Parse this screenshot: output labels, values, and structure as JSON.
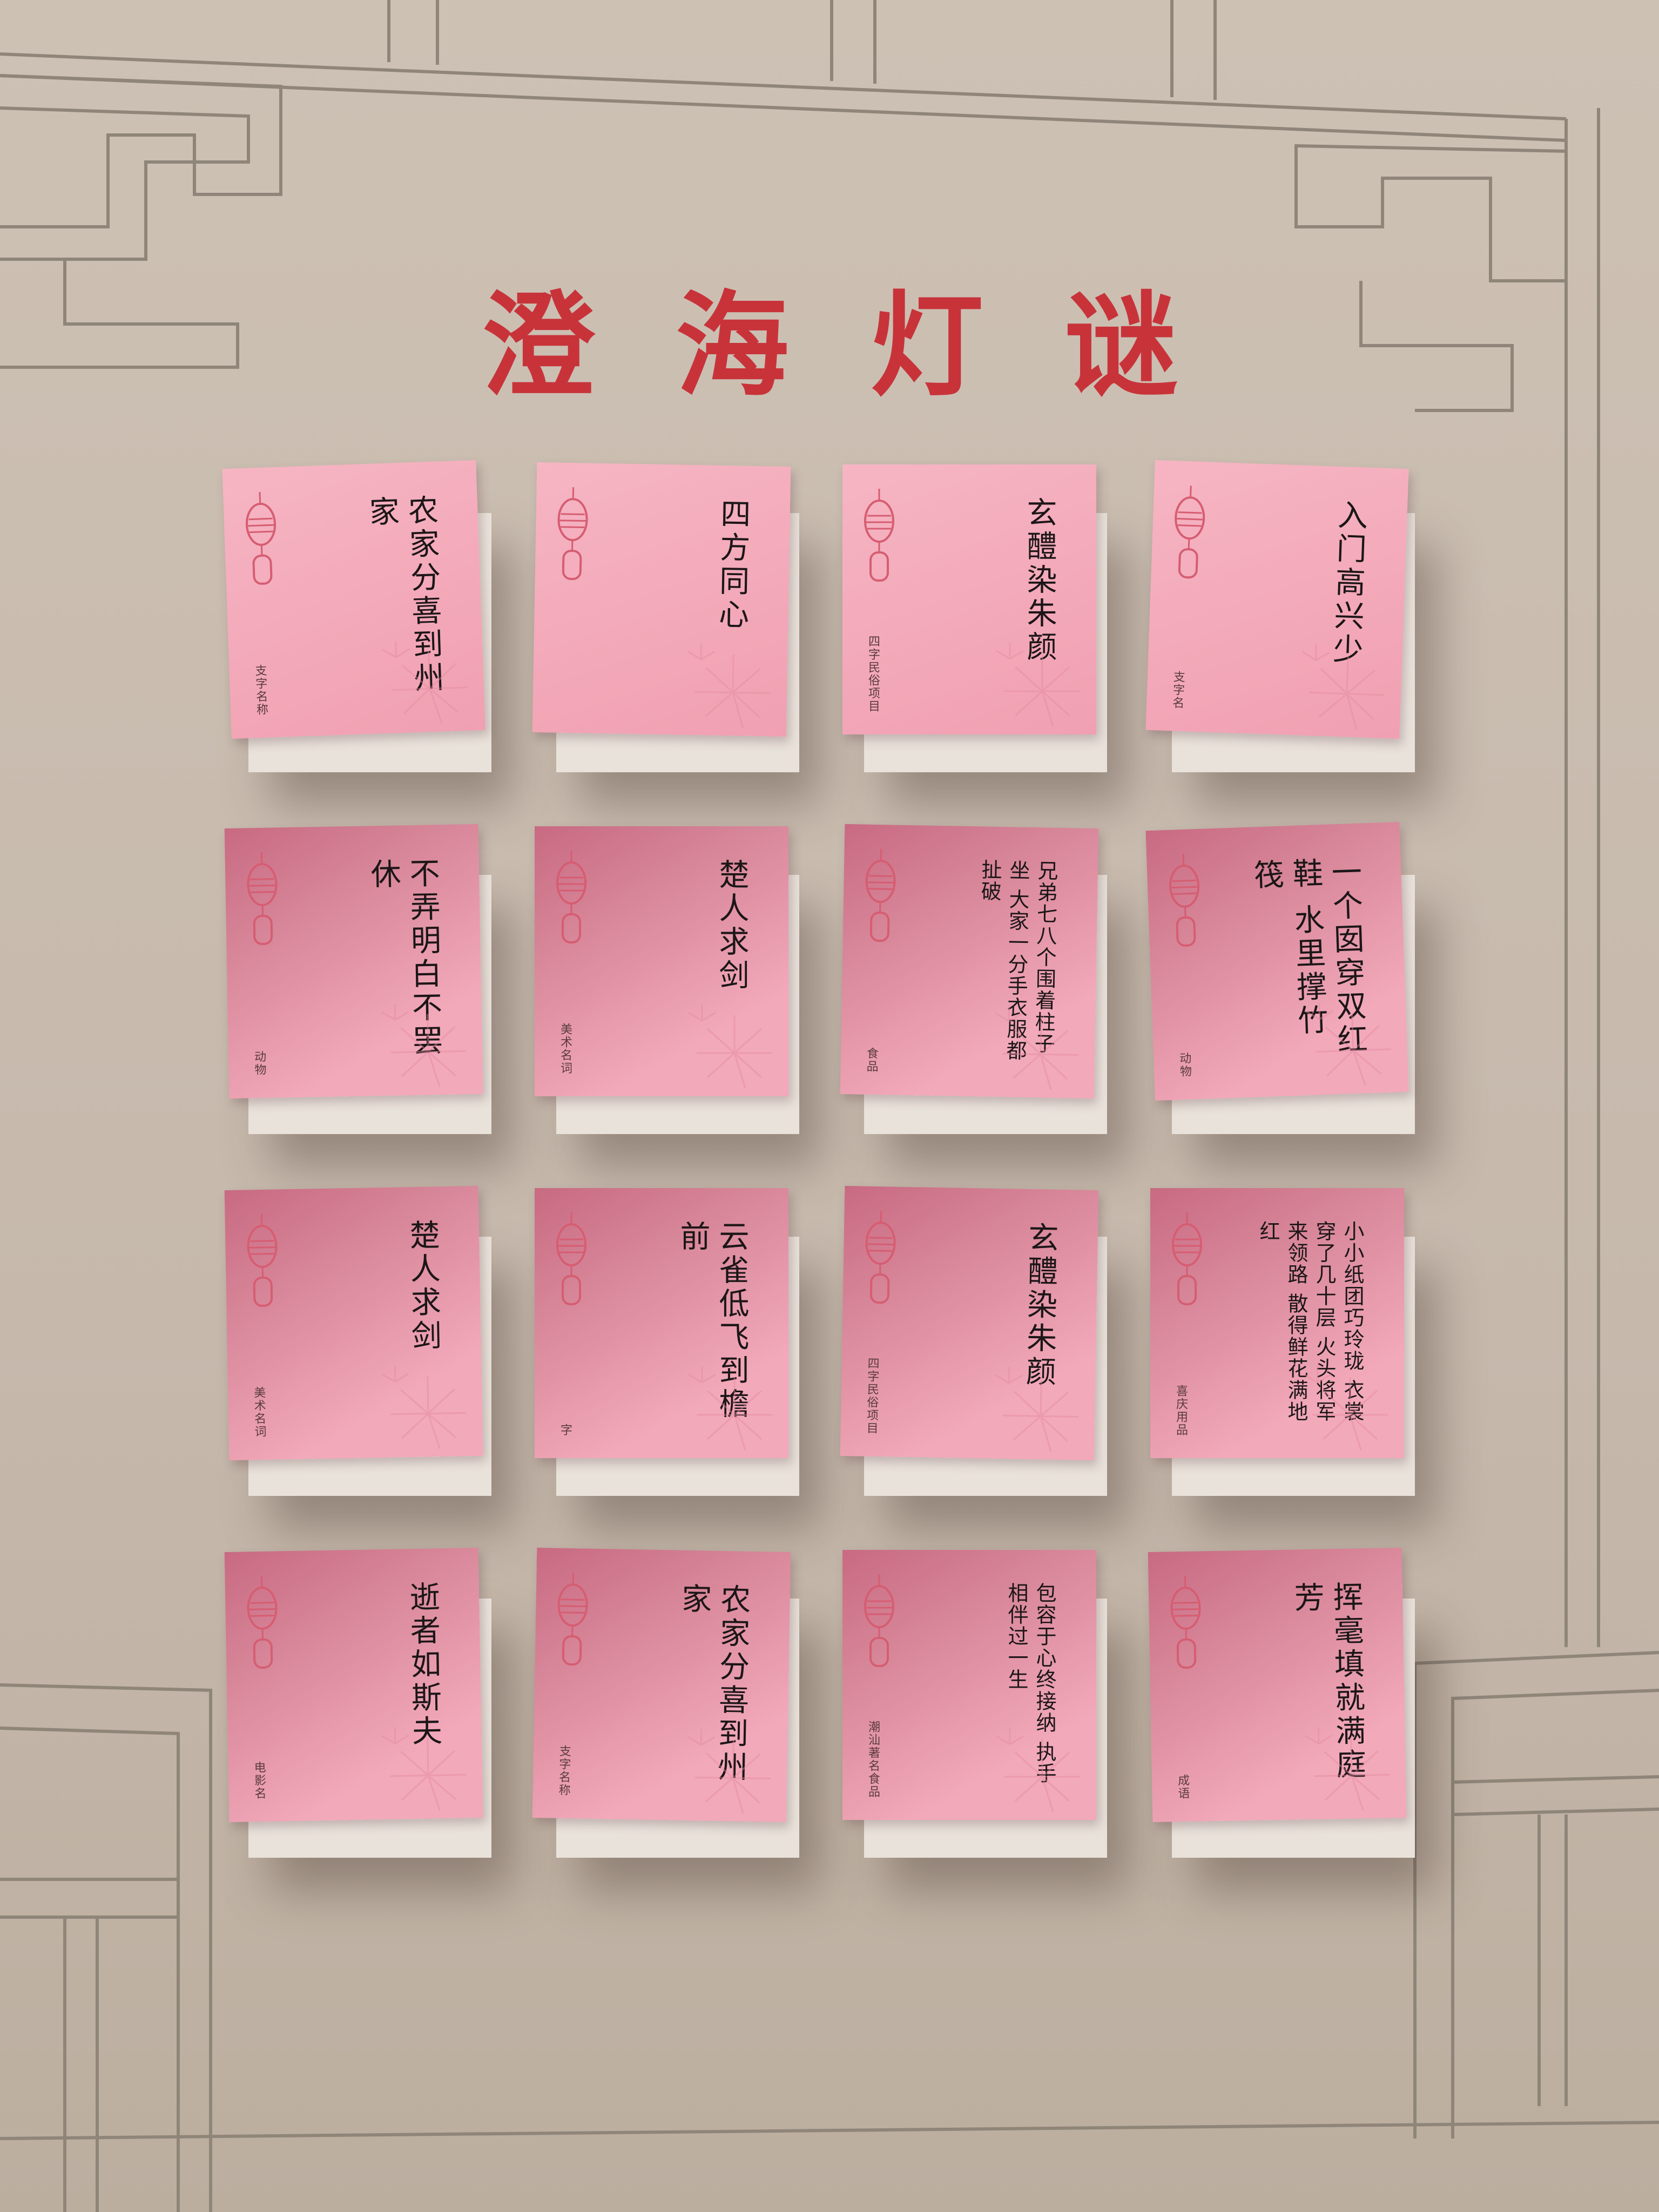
{
  "title": "澄海灯谜",
  "colors": {
    "title_red": "#c8333a",
    "paper_pink": "#f4adbd",
    "wall": "#c9bdb0"
  },
  "riddles": [
    {
      "text": "农家分喜到州家",
      "hint": "支字名称"
    },
    {
      "text": "四方同心",
      "hint": ""
    },
    {
      "text": "玄醴染朱颜",
      "hint": "四字民俗项目"
    },
    {
      "text": "入门高兴少",
      "hint": "支字名"
    },
    {
      "text": "不弄明白不罢休",
      "hint": "动物"
    },
    {
      "text": "楚人求剑",
      "hint": "美术名词"
    },
    {
      "text": "兄弟七八个围着柱子坐 大家一分手衣服都扯破",
      "hint": "食品",
      "small": true
    },
    {
      "text": "一个囡穿双红鞋 水里撑竹筏",
      "hint": "动物"
    },
    {
      "text": "楚人求剑",
      "hint": "美术名词"
    },
    {
      "text": "云雀低飞到檐前",
      "hint": "字"
    },
    {
      "text": "玄醴染朱颜",
      "hint": "四字民俗项目"
    },
    {
      "text": "小小纸团巧玲珑 衣裳穿了几十层 火头将军来领路 散得鲜花满地红",
      "hint": "喜庆用品",
      "small": true
    },
    {
      "text": "逝者如斯夫",
      "hint": "电影名"
    },
    {
      "text": "农家分喜到州家",
      "hint": "支字名称"
    },
    {
      "text": "包容于心终接纳 执手相伴过一生",
      "hint": "潮汕著名食品",
      "small": true
    },
    {
      "text": "挥毫填就满庭芳",
      "hint": "成语"
    }
  ]
}
